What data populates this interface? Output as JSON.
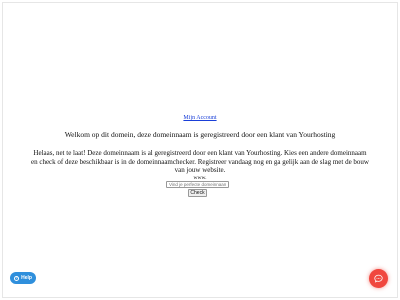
{
  "header": {
    "account_link": "Mijn Account"
  },
  "main": {
    "welcome_text": "Welkom op dit domein, deze domeinnaam is geregistreerd door een klant van Yourhosting",
    "message_text": "Helaas, net te laat! Deze domeinnaam is al geregistreerd door een klant van Yourhosting. Kies een andere domeinnaam en check of deze beschikbaar is in de domeinnaamchecker. Registreer vandaag nog en ga gelijk aan de slag met de bouw van jouw website."
  },
  "checker": {
    "prefix": "www.",
    "placeholder": "Vind je perfecte domeinnaam!",
    "button_label": "Check"
  },
  "widgets": {
    "help_label": "Help",
    "help_icon": "question-circle-icon",
    "chat_icon": "chat-bubble-icon",
    "help_color": "#2f8fdc",
    "chat_color": "#f0473e"
  }
}
